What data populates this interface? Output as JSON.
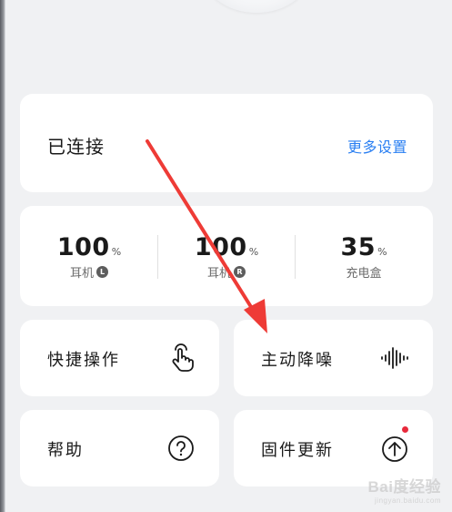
{
  "connection": {
    "status": "已连接",
    "more_settings": "更多设置"
  },
  "battery": [
    {
      "value": "100",
      "unit": "%",
      "label": "耳机",
      "badge": "L"
    },
    {
      "value": "100",
      "unit": "%",
      "label": "耳机",
      "badge": "R"
    },
    {
      "value": "35",
      "unit": "%",
      "label": "充电盒",
      "badge": ""
    }
  ],
  "tiles": {
    "quick": {
      "label": "快捷操作",
      "icon": "tap-gesture-icon"
    },
    "anc": {
      "label": "主动降噪",
      "icon": "sound-wave-icon"
    },
    "help": {
      "label": "帮助",
      "icon": "question-circle-icon"
    },
    "firmware": {
      "label": "固件更新",
      "icon": "upload-circle-icon",
      "has_update": true
    }
  },
  "annotation": {
    "color": "#ee3b36"
  },
  "watermark": {
    "text": "Bai度经验",
    "sub": "jingyan.baidu.com"
  },
  "colors": {
    "accent": "#2a7ff2",
    "background": "#f0f1f3",
    "card": "#ffffff",
    "notify": "#e8293b"
  }
}
